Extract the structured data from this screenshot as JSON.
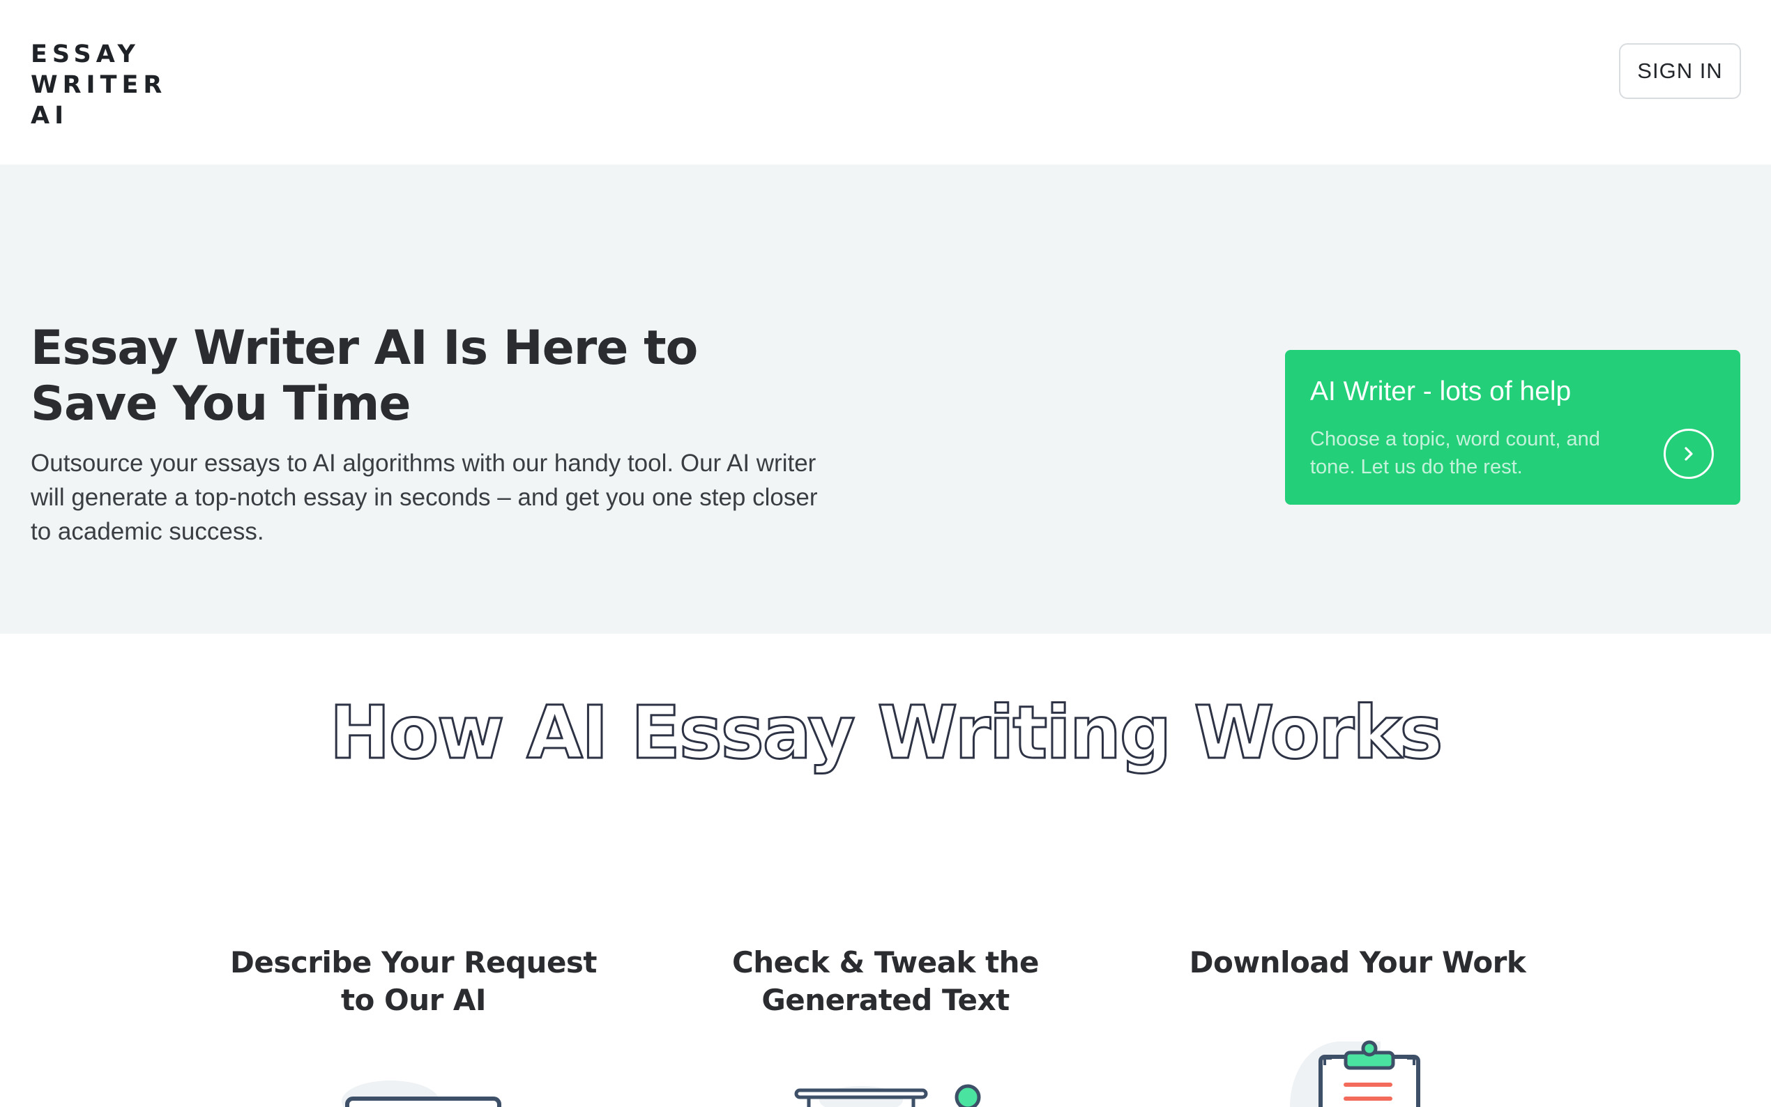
{
  "header": {
    "logo_lines": [
      "ESSAY",
      "WRITER",
      "AI"
    ],
    "signin_label": "SIGN IN"
  },
  "hero": {
    "title": "Essay Writer AI Is Here to Save You Time",
    "description": "Outsource your essays to AI algorithms with our handy tool. Our AI writer will generate a top-notch essay in seconds – and get you one step closer to academic success.",
    "card": {
      "title": "AI Writer - lots of help",
      "description": "Choose a topic, word count, and tone. Let us do the rest.",
      "arrow_icon": "chevron-right-icon"
    }
  },
  "how_it_works": {
    "title": "How AI Essay Writing Works",
    "steps": [
      {
        "title": "Describe Your Request to Our AI",
        "icon": "laptop-illustration"
      },
      {
        "title": "Check & Tweak the Generated Text",
        "icon": "monitor-illustration"
      },
      {
        "title": "Download Your Work",
        "icon": "clipboard-illustration"
      }
    ]
  },
  "colors": {
    "accent_green": "#23cf79",
    "hero_background": "#f1f5f6",
    "outline_text": "#2d3345",
    "illustration_red": "#f26b5b",
    "illustration_blue": "#3d5068"
  }
}
